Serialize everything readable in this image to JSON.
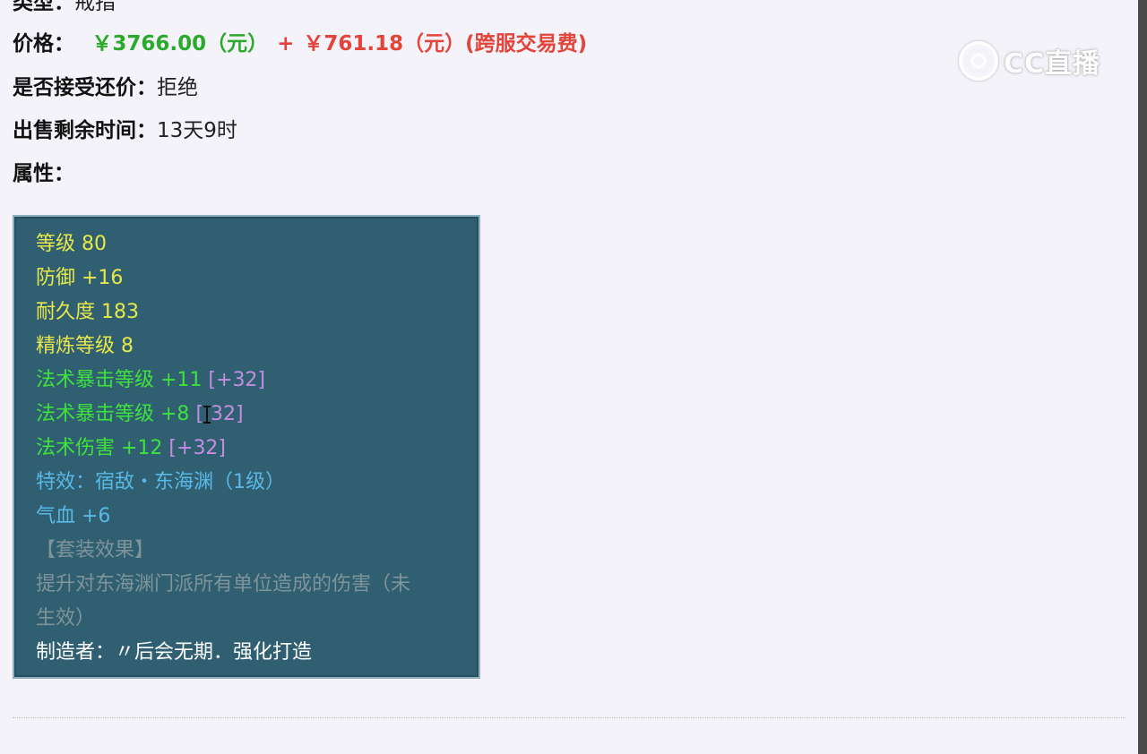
{
  "item": {
    "type_label": "类型：",
    "type_value": "戒指",
    "price_label": "价格：",
    "price_main": "￥3766.00（元）",
    "price_plus": "+",
    "price_fee": "￥761.18（元）(跨服交易费)",
    "counteroffer_label": "是否接受还价：",
    "counteroffer_value": "拒绝",
    "remaining_label": "出售剩余时间：",
    "remaining_value": "13天9时",
    "attributes_label": "属性："
  },
  "attributes": {
    "level": "等级 80",
    "defense": "防御 +16",
    "durability": "耐久度 183",
    "refine": "精炼等级 8",
    "crit1": "法术暴击等级 +11",
    "crit1_bonus": "[+32]",
    "crit2": "法术暴击等级 +8",
    "crit2_bonus_open": "[",
    "crit2_bonus_rest": "32]",
    "damage": "法术伤害 +12",
    "damage_bonus": "[+32]",
    "effect": "特效：宿敌・东海渊（1级）",
    "hp": "气血 +6",
    "set_title": "【套装效果】",
    "set_desc_1": "提升对东海渊门派所有单位造成的伤害（未",
    "set_desc_2": "生效）",
    "maker": "制造者：〃后会无期．强化打造"
  },
  "watermark": {
    "text": "CC直播",
    "icon": "cc-live-logo-icon"
  },
  "colors": {
    "box_bg": "#2f5f70",
    "yellow": "#e8e84a",
    "green": "#3ee23e",
    "purple": "#c38ee0",
    "blue": "#5ab8e6",
    "price_green": "#2aaa2a",
    "price_red": "#e4443a"
  }
}
